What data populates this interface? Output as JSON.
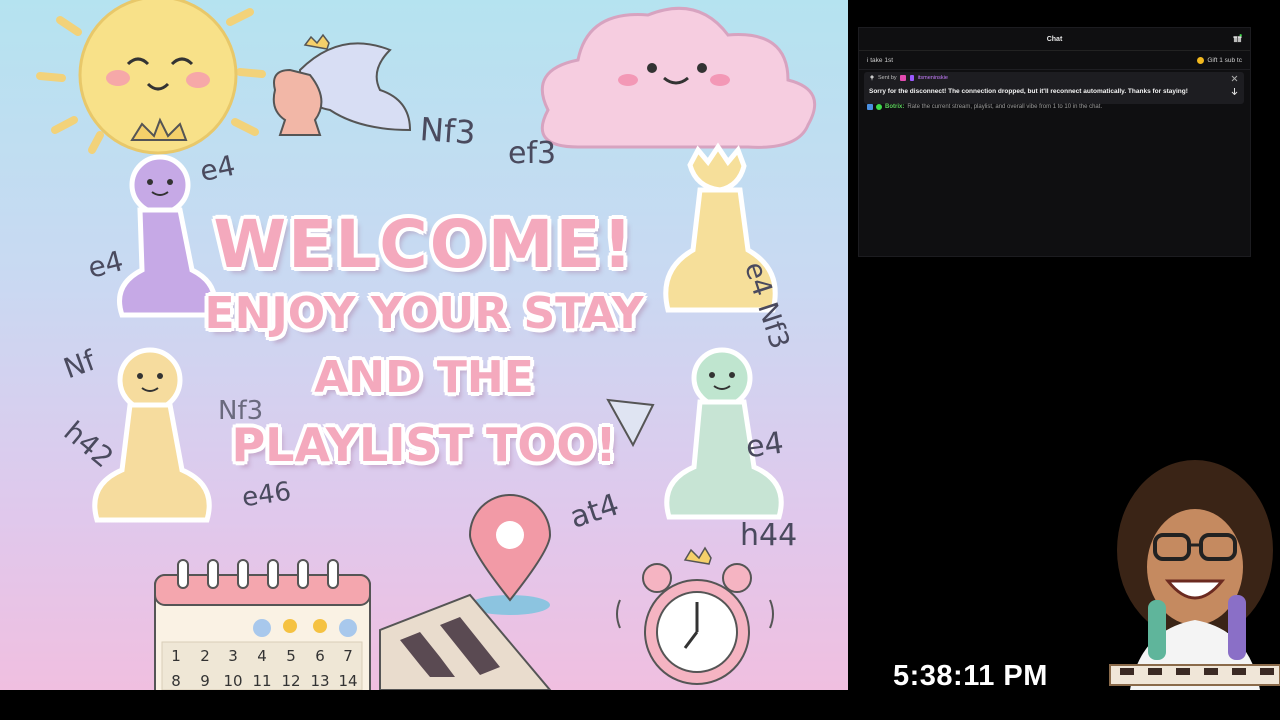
{
  "artwork": {
    "welcome_line1": "WELCOME!",
    "welcome_line2": "ENJOY YOUR STAY",
    "welcome_line3": "AND THE",
    "welcome_line4": "PLAYLIST TOO!",
    "moves": [
      "Nf3",
      "ef3",
      "e4",
      "e4",
      "e4 Nf3",
      "Nf",
      "h42",
      "Nf3",
      "e4",
      "e46",
      "at4",
      "h44"
    ],
    "calendar_numbers": [
      "1",
      "2",
      "3",
      "4",
      "5",
      "6",
      "7",
      "8",
      "9",
      "10",
      "11",
      "12",
      "13",
      "14"
    ],
    "colors": {
      "title_pink": "#f4a9bd",
      "bg_top": "#b5e3f0",
      "bg_bottom": "#f0bfe0"
    }
  },
  "chat": {
    "title": "Chat",
    "pinned_left": "i take 1st",
    "pinned_right": "Gift 1 sub tc",
    "notice_sent_by": "Sent by",
    "notice_user": "itsmeninskie",
    "notice_message": "Sorry for the disconnect! The connection dropped, but it'll reconnect automatically. Thanks for staying!",
    "bot_name": "Botrix:",
    "bot_message": "Rate the current stream, playlist, and overall vibe from 1 to 10 in the chat."
  },
  "clock": {
    "time": "5:38:11 PM"
  }
}
